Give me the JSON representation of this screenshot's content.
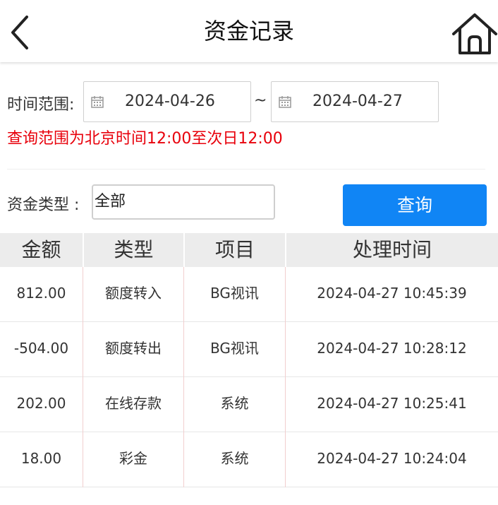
{
  "header": {
    "title": "资金记录",
    "back_icon": "chevron-left-icon",
    "home_icon": "home-icon"
  },
  "filter": {
    "time_label": "时间范围:",
    "start_date": "2024-04-26",
    "separator": "~",
    "end_date": "2024-04-27",
    "note": "查询范围为北京时间12:00至次日12:00",
    "type_label": "资金类型 :",
    "type_value": "全部",
    "query_label": "查询"
  },
  "table": {
    "headers": [
      "金额",
      "类型",
      "项目",
      "处理时间"
    ],
    "rows": [
      [
        "812.00",
        "额度转入",
        "BG视讯",
        "2024-04-27 10:45:39"
      ],
      [
        "-504.00",
        "额度转出",
        "BG视讯",
        "2024-04-27 10:28:12"
      ],
      [
        "202.00",
        "在线存款",
        "系统",
        "2024-04-27 10:25:41"
      ],
      [
        "18.00",
        "彩金",
        "系统",
        "2024-04-27 10:24:04"
      ]
    ]
  },
  "colors": {
    "accent": "#1085f5",
    "note": "#e8000b",
    "header_bg": "#ececec"
  }
}
